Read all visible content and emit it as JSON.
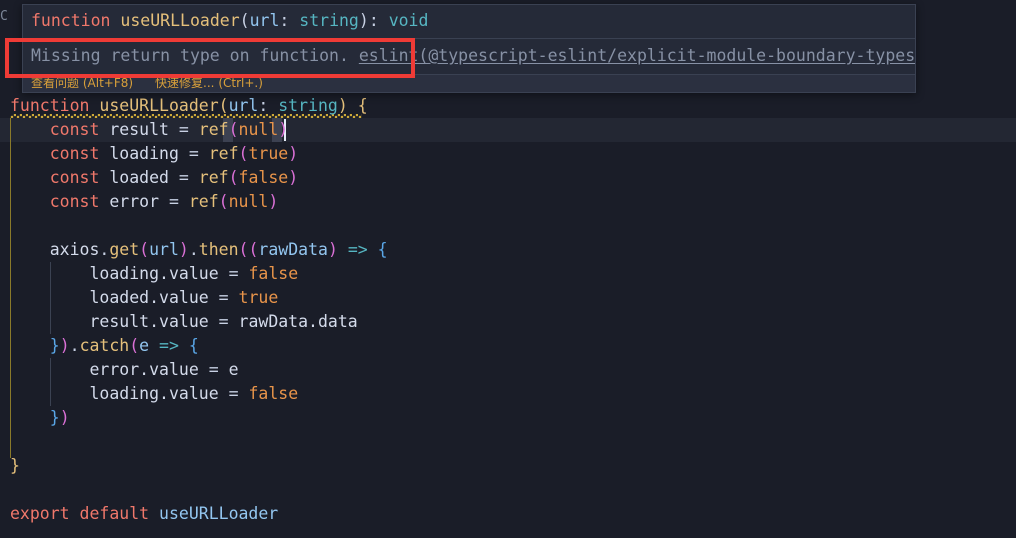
{
  "editor": {
    "background": "#1a1d28",
    "current_line_background": "#232733",
    "language": "typescript",
    "ghost_char": "C",
    "code_lines": [
      {
        "indent": 0,
        "text": "function useURLLoader(url: string) {"
      },
      {
        "indent": 1,
        "text": "const result = ref(null)"
      },
      {
        "indent": 1,
        "text": "const loading = ref(true)"
      },
      {
        "indent": 1,
        "text": "const loaded = ref(false)"
      },
      {
        "indent": 1,
        "text": "const error = ref(null)"
      },
      {
        "indent": 0,
        "text": ""
      },
      {
        "indent": 1,
        "text": "axios.get(url).then((rawData) => {"
      },
      {
        "indent": 2,
        "text": "loading.value = false"
      },
      {
        "indent": 2,
        "text": "loaded.value = true"
      },
      {
        "indent": 2,
        "text": "result.value = rawData.data"
      },
      {
        "indent": 1,
        "text": "}).catch(e => {"
      },
      {
        "indent": 2,
        "text": "error.value = e"
      },
      {
        "indent": 2,
        "text": "loading.value = false"
      },
      {
        "indent": 1,
        "text": "})"
      },
      {
        "indent": 0,
        "text": ""
      },
      {
        "indent": 0,
        "text": "}"
      },
      {
        "indent": 0,
        "text": ""
      },
      {
        "indent": 0,
        "text": "export default useURLLoader"
      }
    ]
  },
  "hover": {
    "signature": {
      "keyword": "function",
      "name": "useURLLoader",
      "open_paren": "(",
      "param_name": "url",
      "colon": ": ",
      "param_type": "string",
      "close_paren": ")",
      "return_colon": ": ",
      "return_type": "void"
    },
    "message": "Missing return type on function.",
    "rule_link": "eslint(@typescript-eslint/explicit-module-boundary-types)",
    "actions": [
      {
        "label": "查看问题",
        "shortcut": "(Alt+F8)"
      },
      {
        "label": "快速修复...",
        "shortcut": "(Ctrl+.)"
      }
    ]
  },
  "annotation": {
    "color": "#ef3b36",
    "shape": "rectangle"
  },
  "tokens": {
    "line1": {
      "kw": "function",
      "fn": " useURLLoader",
      "p1": "(",
      "param": "url",
      "colon": ": ",
      "type": "string",
      "p2": ")",
      "brace": " {"
    },
    "l2": {
      "kw": "const",
      "name": " result ",
      "eq": "= ",
      "fn": "ref",
      "p1": "(",
      "val": "null",
      "p2": ")"
    },
    "l3": {
      "kw": "const",
      "name": " loading ",
      "eq": "= ",
      "fn": "ref",
      "p1": "(",
      "val": "true",
      "p2": ")"
    },
    "l4": {
      "kw": "const",
      "name": " loaded ",
      "eq": "= ",
      "fn": "ref",
      "p1": "(",
      "val": "false",
      "p2": ")"
    },
    "l5": {
      "kw": "const",
      "name": " error ",
      "eq": "= ",
      "fn": "ref",
      "p1": "(",
      "val": "null",
      "p2": ")"
    },
    "l7": {
      "obj": "axios",
      "dot1": ".",
      "get": "get",
      "p1": "(",
      "url": "url",
      "p2": ")",
      "dot2": ".",
      "then": "then",
      "p3": "((",
      "raw": "rawData",
      "p4": ")",
      "arrow": " => ",
      "brace": "{"
    },
    "l8": {
      "obj": "loading",
      "prop": ".value ",
      "eq": "= ",
      "val": "false"
    },
    "l9": {
      "obj": "loaded",
      "prop": ".value ",
      "eq": "= ",
      "val": "true"
    },
    "l10": {
      "obj": "result",
      "prop": ".value ",
      "eq": "= ",
      "val": "rawData.data"
    },
    "l11": {
      "cb": "}",
      "cp": ")",
      "dot": ".",
      "catch": "catch",
      "p1": "(",
      "e": "e",
      "arrow": " => ",
      "brace": "{"
    },
    "l12": {
      "obj": "error",
      "prop": ".value ",
      "eq": "= ",
      "val": "e"
    },
    "l13": {
      "obj": "loading",
      "prop": ".value ",
      "eq": "= ",
      "val": "false"
    },
    "l14": {
      "cb": "}",
      "cp": ")"
    },
    "l16": {
      "brace": "}"
    },
    "l18": {
      "kw1": "export",
      "kw2": " default",
      "name": " useURLLoader"
    }
  }
}
